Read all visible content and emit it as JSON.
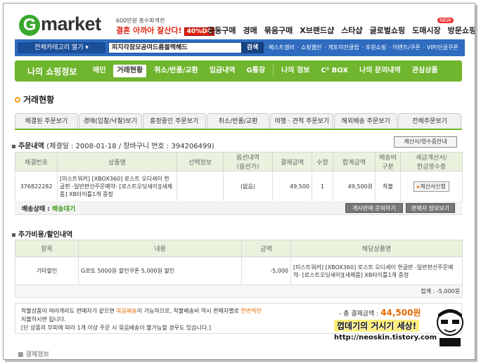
{
  "header": {
    "logo_letter": "G",
    "logo_text": "market",
    "promo_line1": "600만원 총수파격전",
    "promo_line2": "결혼 아까아 잘산다!",
    "promo_badge": "40%DC",
    "topnav": [
      "공동구매",
      "경매",
      "묶음구매",
      "X브랜드샵",
      "스타샵",
      "글로벌쇼핑",
      "도매시장",
      "방문쇼핑몰"
    ],
    "new_badge": "NEW"
  },
  "searchbar": {
    "category_button": "전체카테고리 열기 ▾",
    "search_value": "피지각잠모공여드름블랙헤드",
    "search_button": "검색",
    "links": [
      "· 베스트셀러",
      "· 쇼핑웹진",
      "· 게토미진클럽",
      "· 후원쇼핑",
      "· 이벤트/쿠폰",
      "· VIP/단골쿠폰"
    ]
  },
  "mynav": {
    "title": "나의 쇼핑정보",
    "tabs": [
      "메인",
      "거래현황",
      "취소/반품/교환",
      "입금내역",
      "G통장",
      "나의 정보",
      "C² BOX",
      "나의 문의내역",
      "관심상품"
    ]
  },
  "page_title": "거래현황",
  "subtabs": [
    "체결된 주문보기",
    "경매(입찰/낙찰)보기",
    "흥정중인 주문보기",
    "취소/반품/교환",
    "여행 · 견적 주문보기",
    "해외배송 주문보기",
    "전체주문보기"
  ],
  "order": {
    "title": "주문내역",
    "meta": "(체결일 : 2008-01-18 / 장바구니 번호 : 394206499)",
    "receipt_button": "계산서/영수증안내",
    "columns": [
      "체결번호",
      "상품명",
      "선택정보",
      "옵션내역\n(옵션가)",
      "결제금액",
      "수량",
      "합계금액",
      "배송비\n구분",
      "세금계산서/\n현금영수증"
    ],
    "row": {
      "order_no": "376822282",
      "product": "[미스트워커] [XBOX360] 로스트 오디세이 한글판 -일반판선주문예약- [로스트오딧세이][새제품] XB타이틀1개 증정",
      "option_info": "",
      "option_detail": "(없음)",
      "pay_amount": "49,500",
      "qty": "1",
      "total": "49,500원",
      "shipping": "착불",
      "tax_button": "계산서신청"
    },
    "ship_status_label": "배송상태 :",
    "ship_status_value": "배송대기",
    "board_button": "게시판에 문의하기",
    "seller_button": "판매자 정보보기"
  },
  "extra": {
    "title": "추가비용/할인내역",
    "columns": [
      "항목",
      "내용",
      "금액",
      "해당상품명"
    ],
    "row": {
      "item": "기타할인",
      "content": "G로또 5000원 할인쿠폰 5,000원 할인",
      "amount": "-5,000",
      "product": "[미스트워커] [XBOX360] 로스트 오디세이 한글판 -일반판선주문예약- [로스트오딧세이][새제품] XB타이틀1개 증정"
    },
    "sum": "합계 : -5,000원"
  },
  "notice": {
    "text1": "착불상품이 여러개라도 판매자가 같으면 ",
    "text1_hl": "묶음배송",
    "text1b": "이 가능하므로, 착불배송비 역시 판매자별로 ",
    "text1b_hl": "한번씩만",
    "text2": "지불하시면 됩니다.",
    "text3": "[단 상품의 부피에 따라 1개 이상 주문 시 묶음배송이 불가능할 경우도 있습니다.]",
    "total_label": "- 총 결제금액 :",
    "total_value": "44,500원"
  },
  "watermark": {
    "line1": "껍데기의 거시기 세상!",
    "line2": "http://neoskin.tistory.com"
  },
  "bottom_cut": "■ 결제정보"
}
